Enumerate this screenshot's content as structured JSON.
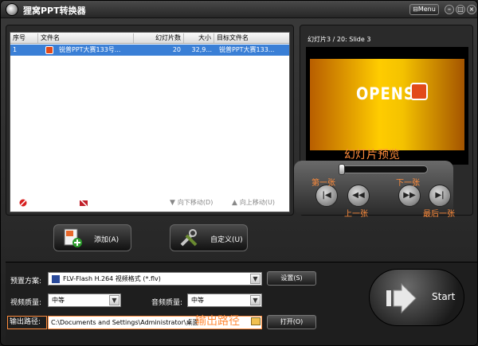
{
  "app": {
    "title": "狸窝PPT转换器",
    "menu_label": "Menu"
  },
  "table": {
    "headers": [
      "序号",
      "文件名",
      "幻灯片数",
      "大小",
      "目标文件名"
    ],
    "rows": [
      {
        "index": "1",
        "filename": "锐普PPT大赛133号...",
        "slides": "20",
        "size": "32,9...",
        "target": "锐普PPT大赛133..."
      }
    ]
  },
  "list_actions": {
    "remove": "移除(R)",
    "clear": "清除(C)",
    "move_down": "向下移动(D)",
    "move_up": "向上移动(U)"
  },
  "preview": {
    "slide_label": "幻灯片3 / 20: Slide 3",
    "slide_text": "OPENS",
    "caption": "幻灯片预览",
    "first_label": "第一张",
    "prev_label": "上一张",
    "next_label": "下一张",
    "last_label": "最后一张",
    "seek_fraction": 0.0
  },
  "buttons": {
    "add": "添加(A)",
    "custom": "自定义(U)"
  },
  "settings": {
    "preset_label": "预置方案:",
    "preset_value": "FLV-Flash H.264 视频格式 (*.flv)",
    "settings_btn": "设置(S)",
    "video_quality_label": "视频质量:",
    "video_quality_value": "中等",
    "audio_quality_label": "音频质量:",
    "audio_quality_value": "中等",
    "output_label": "输出路径:",
    "output_path": "C:\\Documents and Settings\\Administrator\\桌面",
    "output_hint": "输出路径",
    "open_btn": "打开(O)",
    "start_label": "Start"
  },
  "colors": {
    "accent_orange": "#ff8c3c",
    "selection_blue": "#3a7fd6"
  }
}
